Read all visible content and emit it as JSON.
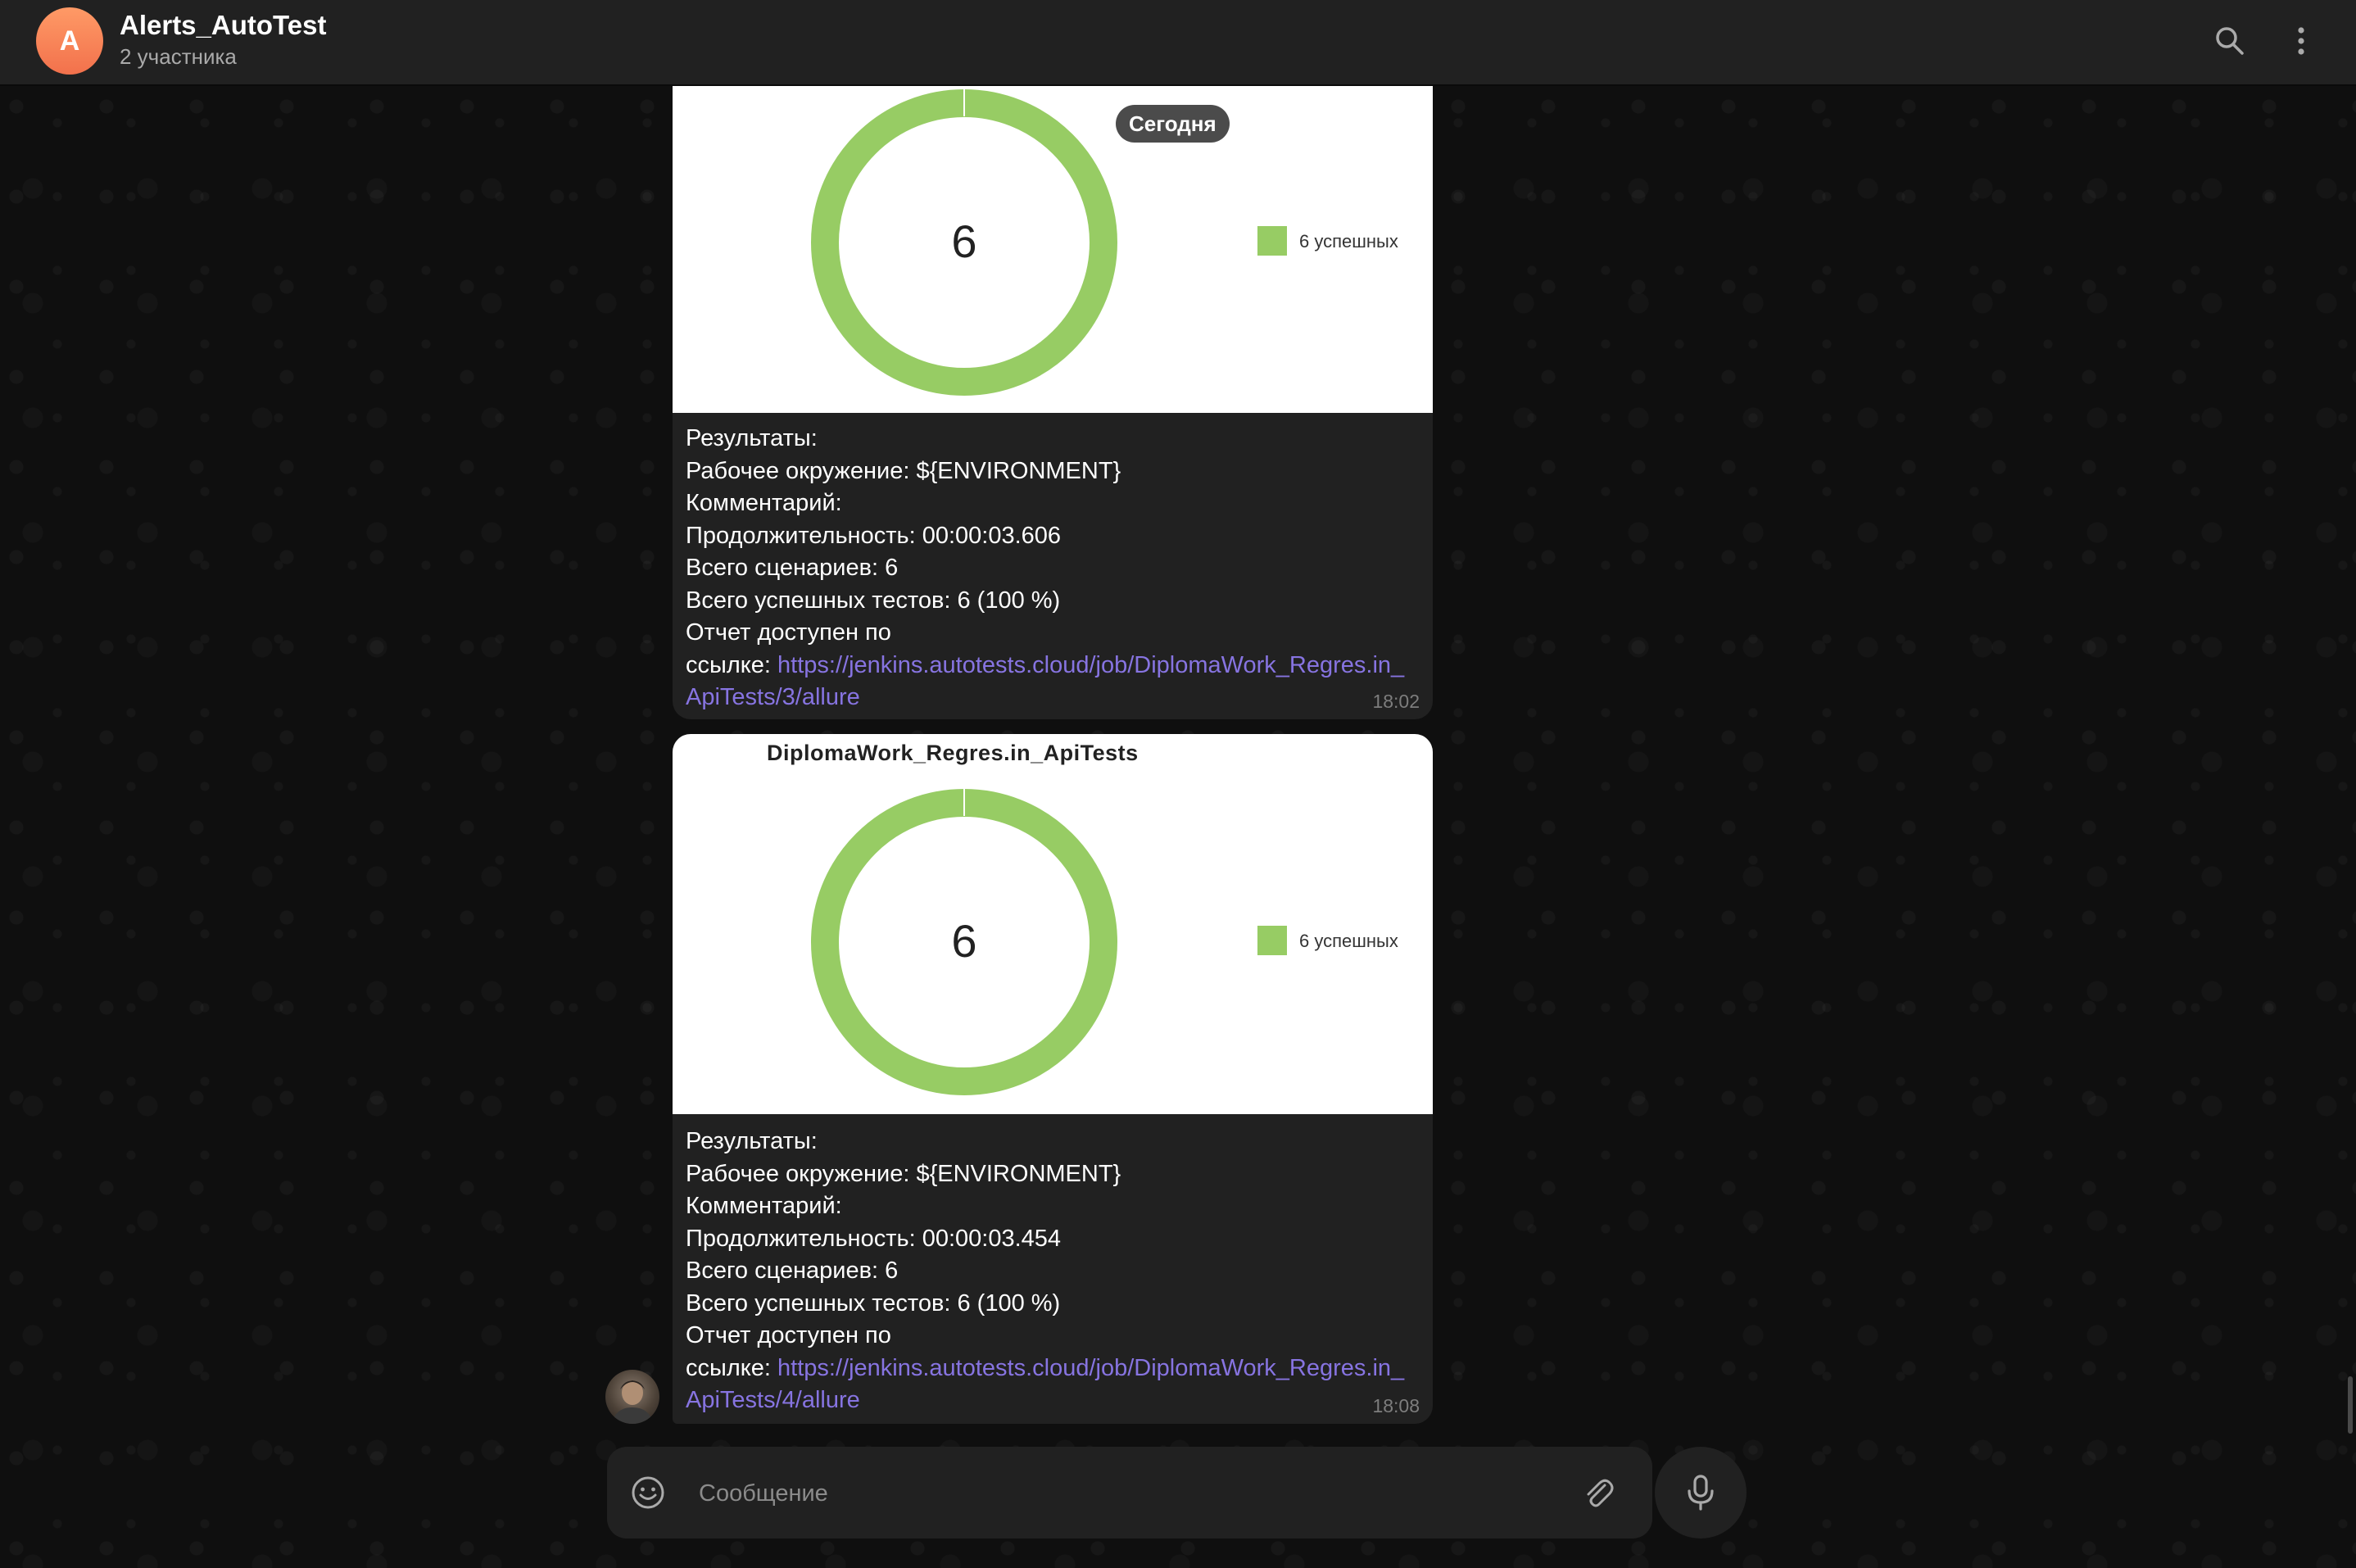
{
  "chat": {
    "avatar_letter": "A",
    "title": "Alerts_AutoTest",
    "subtitle": "2 участника"
  },
  "date_label": "Сегодня",
  "messages": [
    {
      "chart_title": "",
      "donut_total": "6",
      "legend": "6 успешных",
      "lines": [
        "Результаты:",
        "Рабочее окружение: ${ENVIRONMENT}",
        "Комментарий:",
        "Продолжительность: 00:00:03.606",
        "Всего сценариев: 6",
        "Всего успешных тестов: 6 (100 %)",
        "Отчет доступен по"
      ],
      "link_prefix": "ссылке: ",
      "link": "https://jenkins.autotests.cloud/job/DiplomaWork_Regres.in_ApiTests/3/allure",
      "time": "18:02"
    },
    {
      "chart_title": "DiplomaWork_Regres.in_ApiTests",
      "donut_total": "6",
      "legend": "6 успешных",
      "lines": [
        "Результаты:",
        "Рабочее окружение: ${ENVIRONMENT}",
        "Комментарий:",
        "Продолжительность: 00:00:03.454",
        "Всего сценариев: 6",
        "Всего успешных тестов: 6 (100 %)",
        "Отчет доступен по"
      ],
      "link_prefix": "ссылке: ",
      "link": "https://jenkins.autotests.cloud/job/DiplomaWork_Regres.in_ApiTests/4/allure",
      "time": "18:08"
    }
  ],
  "composer": {
    "placeholder": "Сообщение"
  },
  "icons": {
    "search": "search-icon",
    "more": "more-vertical-icon",
    "emoji": "smile-icon",
    "attach": "paperclip-icon",
    "mic": "microphone-icon"
  },
  "colors": {
    "accent": "#8774e1",
    "donut_green": "#97cc64",
    "avatar_orange": "#f2714c",
    "bubble": "#212121"
  }
}
